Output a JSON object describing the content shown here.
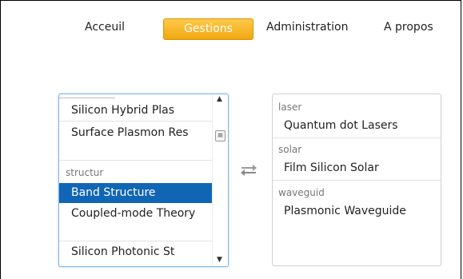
{
  "nav": {
    "items": [
      {
        "label": "Acceuil"
      },
      {
        "label": "Gestions",
        "active": true
      },
      {
        "label": "Administration"
      },
      {
        "label": "A propos"
      }
    ]
  },
  "left_list": {
    "items": [
      {
        "type": "option",
        "label": "Silicon Hybrid Plas"
      },
      {
        "type": "option",
        "label": "Surface Plasmon Res"
      },
      {
        "type": "group",
        "label": "structur"
      },
      {
        "type": "option",
        "label": "Band Structure",
        "selected": true
      },
      {
        "type": "option",
        "label": "Coupled-mode Theory"
      },
      {
        "type": "option",
        "label": "Silicon Photonic St"
      }
    ],
    "scrollbar": {
      "up": "▲",
      "thumb": "≡",
      "down": "▼"
    }
  },
  "swap_icon": "swap-arrows-icon",
  "right_list": {
    "items": [
      {
        "type": "group",
        "label": "laser"
      },
      {
        "type": "option",
        "label": "Quantum dot Lasers"
      },
      {
        "type": "group",
        "label": "solar"
      },
      {
        "type": "option",
        "label": "Film Silicon Solar"
      },
      {
        "type": "group",
        "label": "waveguid"
      },
      {
        "type": "option",
        "label": "Plasmonic Waveguide"
      }
    ]
  },
  "colors": {
    "accent": "#f0a812",
    "selected": "#1066b4",
    "focus_border": "#7eb6e6"
  }
}
